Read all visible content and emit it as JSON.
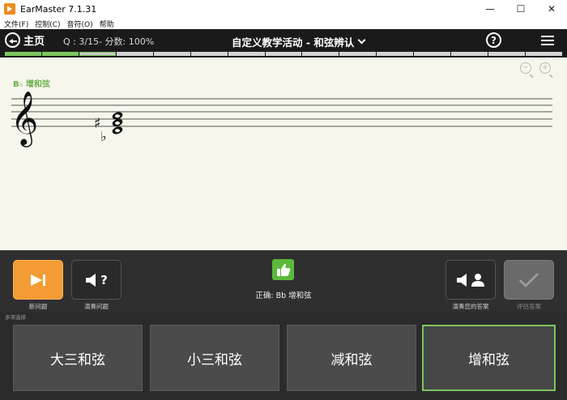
{
  "window": {
    "title": "EarMaster 7.1.31",
    "minimize": "—",
    "maximize": "☐",
    "close": "✕"
  },
  "menu": [
    "文件(F)",
    "控制(C)",
    "音符(O)",
    "帮助"
  ],
  "header": {
    "home_label": "主页",
    "score": "Q : 3/15- 分数: 100%",
    "activity": "自定义教学活动 - 和弦辨认",
    "help_glyph": "?"
  },
  "progress": {
    "total": 15,
    "completed": 2,
    "current": 3
  },
  "staff": {
    "chord_label": "B♭ 增和弦",
    "zoom_out": "−",
    "zoom_in": "+",
    "clef_glyph": "𝄞",
    "sharp_glyph": "♯",
    "flat_glyph": "♭"
  },
  "controls": {
    "new_question": "新问题",
    "play_question": "演奏问题",
    "play_question_glyph": "?",
    "play_answer": "演奏您的答案",
    "evaluate": "评估答案",
    "feedback": "正确: Bb 增和弦"
  },
  "answers": {
    "section_label": "多项选择",
    "options": [
      "大三和弦",
      "小三和弦",
      "减和弦",
      "增和弦"
    ],
    "selected_index": 3
  },
  "colors": {
    "accent_green": "#7dc55e",
    "accent_orange": "#f39c34",
    "thumb_green": "#5cb83a"
  }
}
